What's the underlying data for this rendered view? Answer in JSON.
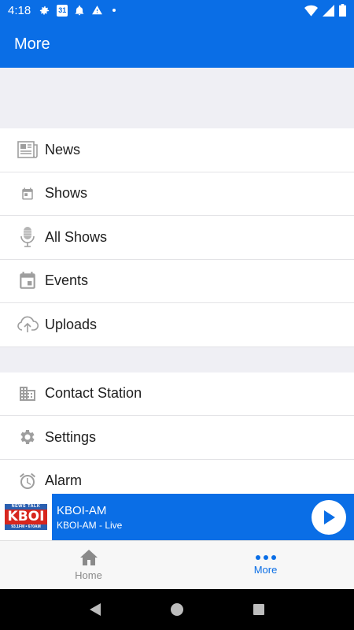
{
  "status_bar": {
    "time": "4:18",
    "calendar_day": "31"
  },
  "app_bar": {
    "title": "More"
  },
  "menu_groups": [
    [
      {
        "label": "News",
        "icon": "newspaper-icon"
      },
      {
        "label": "Shows",
        "icon": "calendar-small-icon"
      },
      {
        "label": "All Shows",
        "icon": "microphone-icon"
      },
      {
        "label": "Events",
        "icon": "calendar-icon"
      },
      {
        "label": "Uploads",
        "icon": "cloud-upload-icon"
      }
    ],
    [
      {
        "label": "Contact Station",
        "icon": "building-icon"
      },
      {
        "label": "Settings",
        "icon": "gear-icon"
      },
      {
        "label": "Alarm",
        "icon": "alarm-clock-icon"
      }
    ]
  ],
  "player": {
    "logo_top": "NEWS TALK",
    "logo_main": "KBOI",
    "logo_freq": "93.1FM • 670AM",
    "station": "KBOI-AM",
    "subtitle": "KBOI-AM - Live"
  },
  "bottom_nav": {
    "home_label": "Home",
    "more_label": "More"
  },
  "colors": {
    "accent": "#0a6ee6",
    "icon_gray": "#9e9e9e",
    "logo_red": "#d7261e"
  }
}
